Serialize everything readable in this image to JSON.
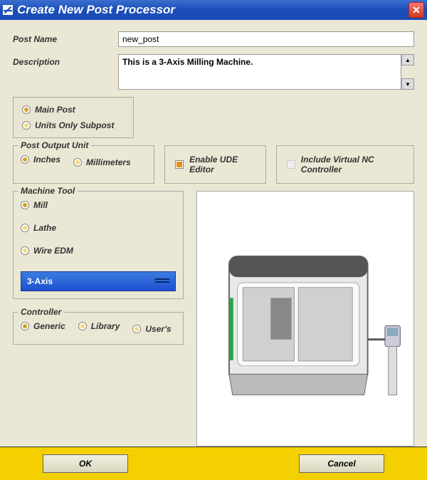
{
  "title": "Create New Post Processor",
  "labels": {
    "post_name": "Post Name",
    "description": "Description"
  },
  "fields": {
    "post_name": "new_post",
    "description": "This is a 3-Axis Milling Machine."
  },
  "post_type": {
    "main": "Main Post",
    "units_only": "Units Only Subpost"
  },
  "output_unit": {
    "legend": "Post Output Unit",
    "inches": "Inches",
    "millimeters": "Millimeters"
  },
  "options": {
    "enable_ude": "Enable UDE Editor",
    "include_vnc": "Include Virtual NC Controller"
  },
  "machine_tool": {
    "legend": "Machine Tool",
    "mill": "Mill",
    "lathe": "Lathe",
    "wire_edm": "Wire EDM",
    "axis": "3-Axis"
  },
  "controller": {
    "legend": "Controller",
    "generic": "Generic",
    "library": "Library",
    "users": "User's"
  },
  "buttons": {
    "ok": "OK",
    "cancel": "Cancel"
  }
}
